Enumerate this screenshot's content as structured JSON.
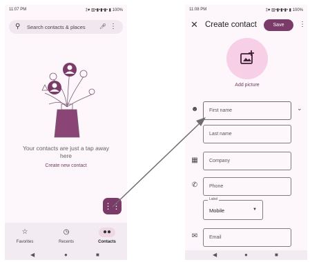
{
  "left": {
    "status": {
      "time": "11:07 PM",
      "system": "‡♥ ▧•▮•▮•▮• ▮ 100%"
    },
    "search": {
      "placeholder": "Search contacts & places"
    },
    "empty_text": "Your contacts are just a tap away here",
    "create_link": "Create new contact",
    "nav": [
      {
        "label": "Favorites",
        "icon": "star-icon"
      },
      {
        "label": "Recents",
        "icon": "clock-icon"
      },
      {
        "label": "Contacts",
        "icon": "people-icon",
        "active": true
      }
    ]
  },
  "right": {
    "status": {
      "time": "11:08 PM",
      "system": "‡♥ ▧•▮•▮•▮• ▮ 100%"
    },
    "title": "Create contact",
    "save_label": "Save",
    "add_picture": "Add picture",
    "fields": {
      "first_name": "First name",
      "last_name": "Last name",
      "company": "Company",
      "phone": "Phone",
      "label_legend": "Label",
      "label_value": "Mobile",
      "email": "Email"
    }
  },
  "colors": {
    "accent": "#7a3b68",
    "avatar_bg": "#f7cfe6",
    "arrow": "#6d6d6d"
  }
}
